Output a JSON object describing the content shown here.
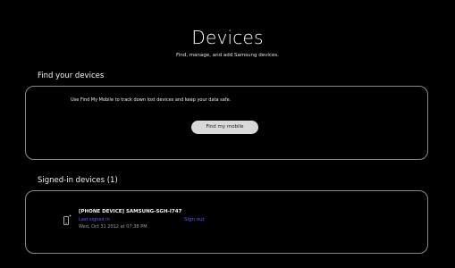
{
  "header": {
    "title": "Devices",
    "subtitle": "Find, manage, and add Samsung devices."
  },
  "find_section": {
    "heading": "Find your devices",
    "description": "Use Find My Mobile to track down lost devices and keep your data safe.",
    "button_label": "Find my mobile"
  },
  "signed_in_section": {
    "heading": "Signed-in devices (1)",
    "devices": [
      {
        "icon": "phone-icon",
        "name": "[PHONE DEVICE] SAMSUNG-SGH-I747",
        "last_signed_label": "Last signed in",
        "last_signed_date": "Wed, Oct 31 2012 at 07:38 PM",
        "sign_out_label": "Sign out"
      }
    ]
  },
  "colors": {
    "background": "#000000",
    "link": "#5a5cff",
    "button": "#d9d9d9",
    "card_border": "#8a8a8a"
  }
}
